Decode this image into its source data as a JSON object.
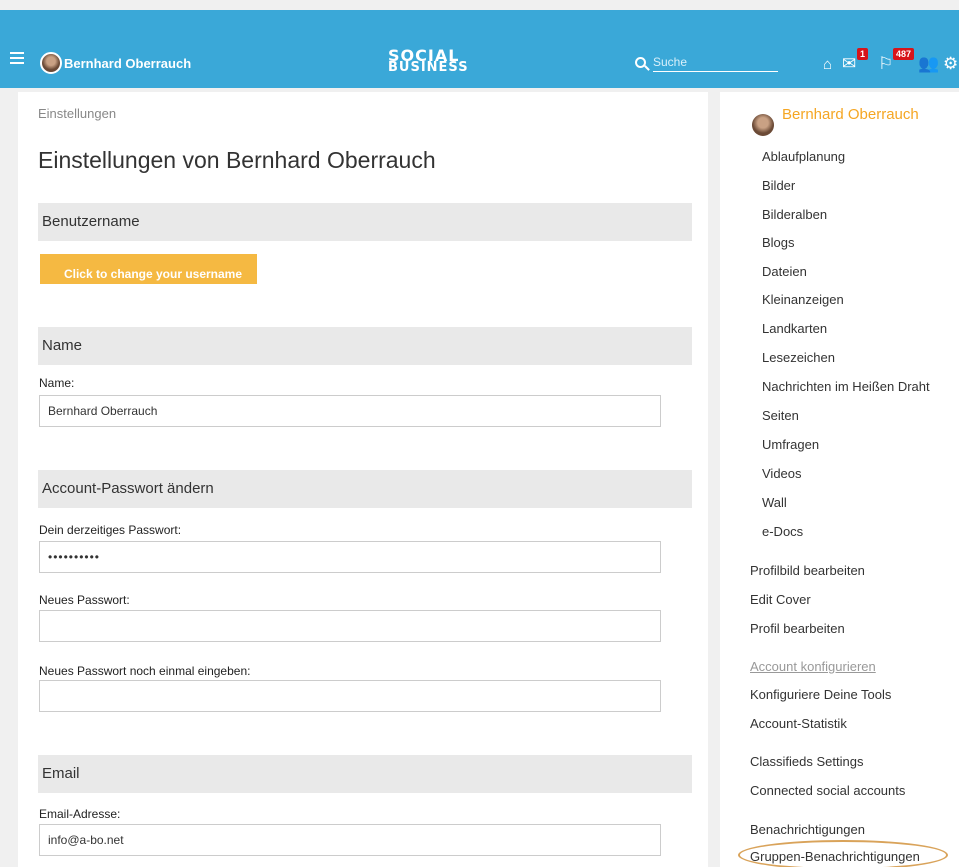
{
  "header": {
    "user_name": "Bernhard Oberrauch",
    "logo_line1": "SOCIAL",
    "logo_line2": "BUSINESS",
    "search_placeholder": "Suche",
    "messages_badge": "1",
    "notifications_badge": "487",
    "flags": [
      "flag-uk",
      "flag-de",
      "flag-it",
      "flag-nl",
      "flag-es",
      "flag-fr"
    ],
    "icons": [
      "menu-icon",
      "search-icon",
      "home-icon",
      "mail-icon",
      "flag-notify-icon",
      "people-icon",
      "gear-icon"
    ],
    "colors": {
      "bar": "#3aa8d8",
      "badge": "#d7141a"
    }
  },
  "main": {
    "breadcrumb": "Einstellungen",
    "title": "Einstellungen von Bernhard Oberrauch",
    "sections": {
      "username": "Benutzername",
      "name": "Name",
      "password": "Account-Passwort ändern",
      "email": "Email"
    },
    "change_username_button": "Click to change your username",
    "name_label": "Name:",
    "name_value": "Bernhard Oberrauch",
    "current_password_label": "Dein derzeitiges Passwort:",
    "current_password_value": "••••••••••",
    "new_password_label": "Neues Passwort:",
    "new_password_repeat_label": "Neues Passwort noch einmal eingeben:",
    "email_label": "Email-Adresse:",
    "email_value": "info@a-bo.net",
    "accent_color": "#f5b942"
  },
  "sidebar": {
    "user_name": "Bernhard Oberrauch",
    "tools": [
      "Ablaufplanung",
      "Bilder",
      "Bilderalben",
      "Blogs",
      "Dateien",
      "Kleinanzeigen",
      "Landkarten",
      "Lesezeichen",
      "Nachrichten im Heißen Draht",
      "Seiten",
      "Umfragen",
      "Videos",
      "Wall",
      "e-Docs"
    ],
    "profile_links": [
      "Profilbild bearbeiten",
      "Edit Cover",
      "Profil bearbeiten"
    ],
    "account_heading": "Account konfigurieren",
    "account_links": [
      "Konfiguriere Deine Tools",
      "Account-Statistik"
    ],
    "settings_links": [
      "Classifieds Settings",
      "Connected social accounts"
    ],
    "notify_links": [
      "Benachrichtigungen",
      "Gruppen-Benachrichtigungen"
    ],
    "highlight_color": "#d9a35a"
  }
}
